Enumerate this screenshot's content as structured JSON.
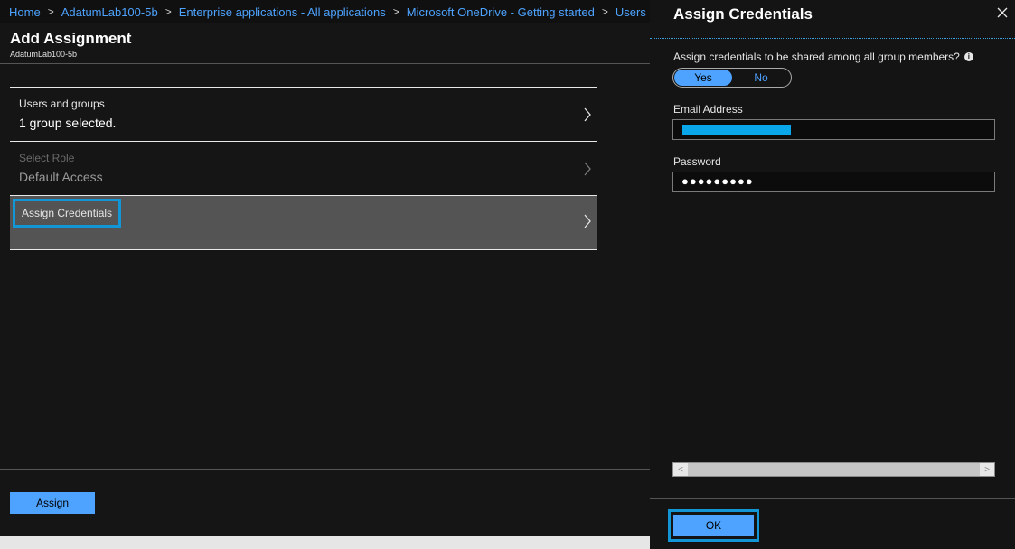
{
  "breadcrumb": {
    "items": [
      "Home",
      "AdatumLab100-5b",
      "Enterprise applications - All applications",
      "Microsoft OneDrive - Getting started",
      "Users a"
    ],
    "separator": ">"
  },
  "left_blade": {
    "title": "Add Assignment",
    "subtitle": "AdatumLab100-5b",
    "items": [
      {
        "label": "Users and groups",
        "value": "1 group selected."
      },
      {
        "label": "Select Role",
        "value": "Default Access"
      },
      {
        "label": "Assign Credentials",
        "value": ""
      }
    ],
    "assign_label": "Assign"
  },
  "right_blade": {
    "title": "Assign Credentials",
    "question": "Assign credentials to be shared among all group members?",
    "toggle": {
      "yes": "Yes",
      "no": "No",
      "selected": "Yes"
    },
    "email_label": "Email Address",
    "password_label": "Password",
    "password_value": "●●●●●●●●●",
    "ok_label": "OK"
  },
  "colors": {
    "accent": "#4da3ff",
    "highlight_border": "#1296d6",
    "redaction": "#0aa6ea"
  },
  "icons": {
    "chevron": "chevron-right-icon",
    "close": "close-icon",
    "info": "info-icon"
  }
}
